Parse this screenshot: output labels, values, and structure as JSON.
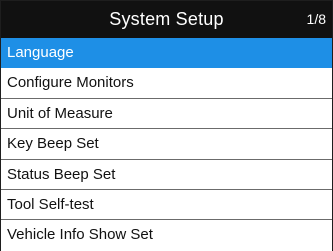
{
  "header": {
    "title": "System Setup",
    "page_indicator": "1/8"
  },
  "menu": {
    "selected_index": 0,
    "items": [
      {
        "label": "Language"
      },
      {
        "label": "Configure Monitors"
      },
      {
        "label": "Unit of Measure"
      },
      {
        "label": "Key Beep Set"
      },
      {
        "label": "Status Beep Set"
      },
      {
        "label": "Tool Self-test"
      },
      {
        "label": "Vehicle Info Show Set"
      }
    ]
  },
  "colors": {
    "header_background": "#111111",
    "selection_highlight": "#1e8fe6",
    "divider": "#6b6b6b"
  }
}
